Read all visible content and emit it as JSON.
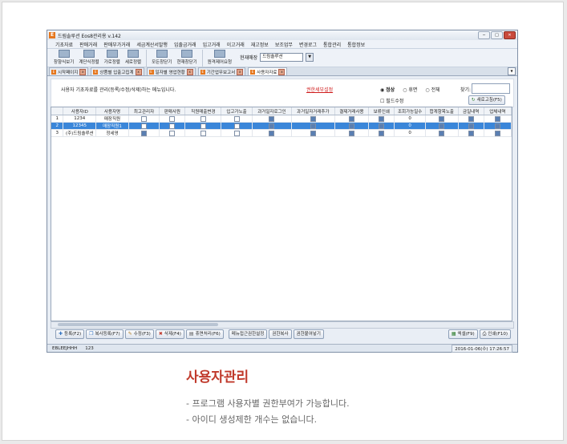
{
  "window": {
    "title": "드림솔루션 Eos8관리용 v.142",
    "buttons": {
      "min": "─",
      "max": "□",
      "close": "✕"
    }
  },
  "menu": [
    "기초자료",
    "판매거래",
    "판매부가거래",
    "세금계산서발행",
    "입출금거래",
    "입고거래",
    "이고거래",
    "재고정보",
    "보조업무",
    "변경로그",
    "통합관리",
    "통합정보"
  ],
  "toolbar": {
    "items": [
      "창향식보기",
      "계단식정렬",
      "가로정렬",
      "세로정렬",
      "모든창닫기",
      "현재창닫기",
      "원격제어요청"
    ],
    "store_label": "현재매장",
    "store_value": "드림솔루션"
  },
  "tabs": [
    {
      "label": "시작페이지"
    },
    {
      "label": "상품별 입출고집계"
    },
    {
      "label": "일자별 영업현황"
    },
    {
      "label": "기간업무보고서"
    },
    {
      "label": "사용자자료"
    }
  ],
  "info": {
    "description": "사용자 기초자료를 관리(등록/수정/삭제)하는 메뉴입니다.",
    "link": "권한세부설정",
    "radio_normal": "정상",
    "radio_resign": "휴면",
    "radio_all": "전체",
    "search_label": "찾기:",
    "check_required": "필드수정",
    "refresh": "새로고침(F5)"
  },
  "grid": {
    "columns": [
      "사용자ID",
      "사용자명",
      "최고관리자",
      "판매사원",
      "직원매출변경",
      "입고가노출",
      "과거일자로그인",
      "과거일자거래추가",
      "결제거래사용",
      "보류인쇄",
      "조회가능일수",
      "합계항목노출",
      "금일내역",
      "업체내역"
    ],
    "rows": [
      {
        "no": "1",
        "id": "1234",
        "name": "매장직원",
        "flags": [
          false,
          false,
          false,
          false,
          true,
          true,
          true,
          true
        ],
        "days": "0",
        "tail": [
          true,
          true,
          true
        ]
      },
      {
        "no": "2",
        "id": "12345",
        "name": "매장직원1",
        "flags": [
          false,
          false,
          false,
          false,
          true,
          true,
          true,
          true
        ],
        "days": "0",
        "tail": [
          true,
          true,
          true
        ]
      },
      {
        "no": "3",
        "id": "(주)드림솔루션",
        "name": "정세영",
        "flags": [
          true,
          false,
          false,
          false,
          true,
          true,
          true,
          true
        ],
        "days": "0",
        "tail": [
          true,
          true,
          true
        ]
      }
    ]
  },
  "buttons": {
    "add": "등록(F2)",
    "copy": "복사등록(F7)",
    "edit": "수정(F3)",
    "delete": "삭제(F4)",
    "restore": "휴면처리(F6)",
    "menu_access": "메뉴접근권한설정",
    "perm_copy": "권한복사",
    "perm_paste": "권한붙여넣기",
    "excel": "엑셀(F9)",
    "print": "인쇄(F10)"
  },
  "status": {
    "user": "EBLEEJHHH",
    "code": "123",
    "datetime": "2016-01-06(수) 17:26:57"
  },
  "caption": {
    "title": "사용자관리",
    "line1": "- 프로그램 사용자별 권한부여가 가능합니다.",
    "line2": "- 아이디 생성제한 개수는 없습니다."
  }
}
